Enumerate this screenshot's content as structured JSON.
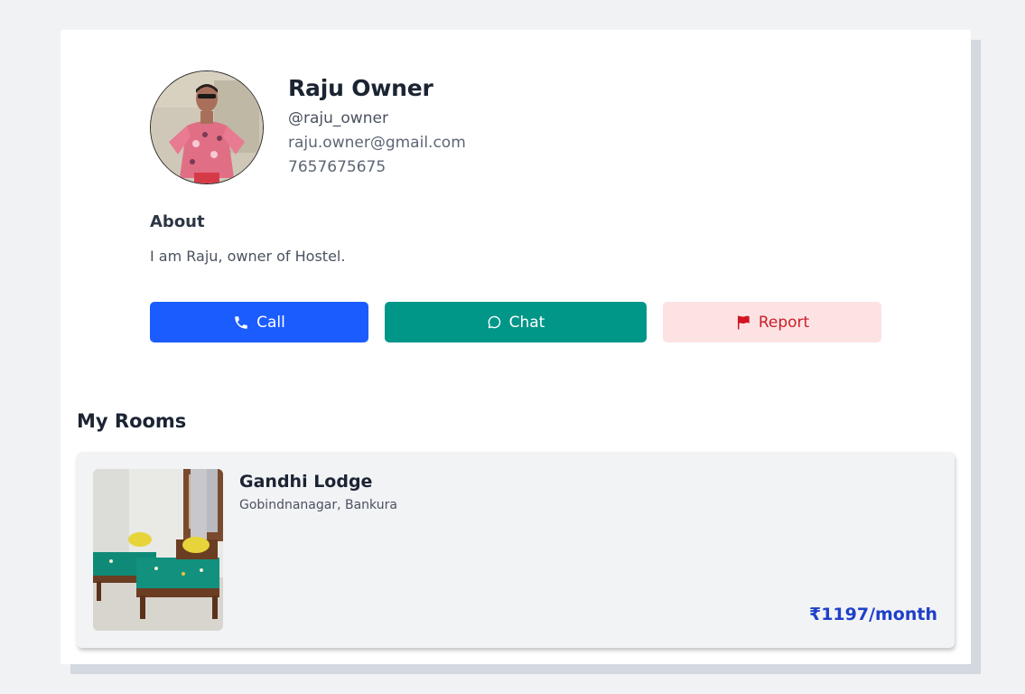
{
  "profile": {
    "name": "Raju Owner",
    "username": "@raju_owner",
    "email": "raju.owner@gmail.com",
    "phone": "7657675675"
  },
  "about": {
    "heading": "About",
    "text": "I am Raju, owner of Hostel."
  },
  "actions": {
    "call_label": "Call",
    "chat_label": "Chat",
    "report_label": "Report",
    "call_color": "#1b5cff",
    "chat_color": "#009688",
    "report_color": "#c81e28",
    "report_bg": "#fde2e3"
  },
  "icons": {
    "call": "phone-icon",
    "chat": "chat-bubble-icon",
    "report": "flag-icon"
  },
  "rooms": {
    "heading": "My Rooms",
    "items": [
      {
        "title": "Gandhi Lodge",
        "location": "Gobindnanagar, Bankura",
        "price": "₹1197/month"
      }
    ]
  },
  "colors": {
    "price": "#1e40c8",
    "page_background": "#f1f2f4"
  }
}
